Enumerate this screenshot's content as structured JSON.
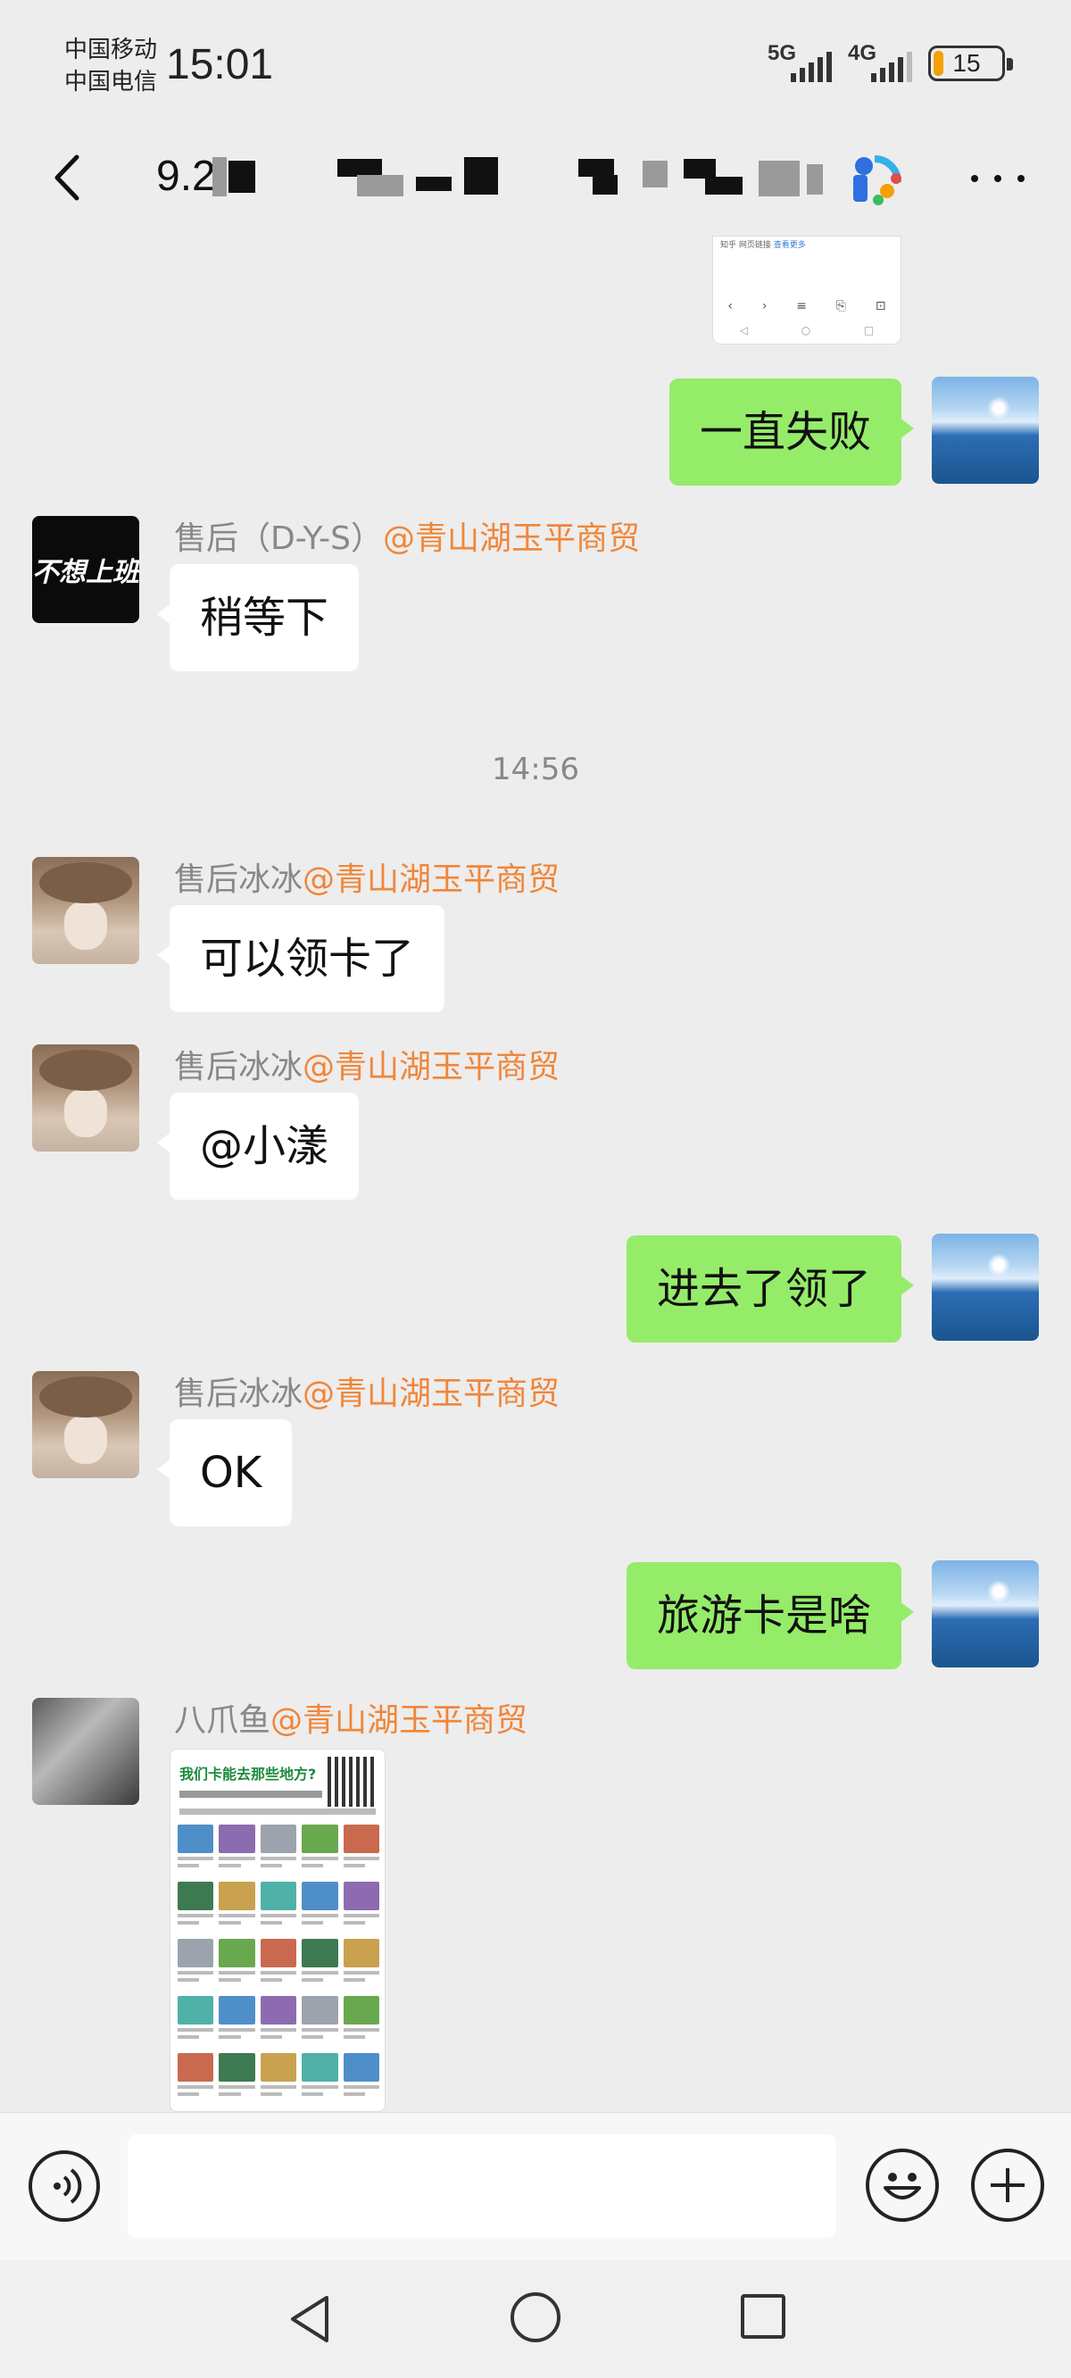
{
  "status_bar": {
    "carrier1": "中国移动",
    "carrier2": "中国电信",
    "time": "15:01",
    "net1": "5G",
    "net2": "4G",
    "battery": "15",
    "battery_level": 0.15,
    "battery_color": "#f3a000"
  },
  "title_bar": {
    "title": "9.2",
    "back_icon": "chevron-left-icon",
    "more_icon": "more-icon"
  },
  "chat": {
    "screenshot_card": {
      "text_prefix": "知乎 网页链接",
      "text_link": "查看更多",
      "nav_row": [
        "‹",
        "›",
        "≡",
        "⎘",
        "⊡"
      ],
      "sys_row": [
        "◁",
        "○",
        "□"
      ]
    },
    "messages": [
      {
        "side": "right",
        "text": "一直失败"
      },
      {
        "side": "left",
        "sender_name": "售后（D-Y-S）",
        "sender_org": "@青山湖玉平商贸",
        "text": "稍等下",
        "avatar_text": "不想上班"
      },
      {
        "timestamp": "14:56"
      },
      {
        "side": "left",
        "sender_name": "售后冰冰",
        "sender_org": "@青山湖玉平商贸",
        "text": "可以领卡了"
      },
      {
        "side": "left",
        "sender_name": "售后冰冰",
        "sender_org": "@青山湖玉平商贸",
        "text": "@小漾"
      },
      {
        "side": "right",
        "text": "进去了领了"
      },
      {
        "side": "left",
        "sender_name": "售后冰冰",
        "sender_org": "@青山湖玉平商贸",
        "text": "OK"
      },
      {
        "side": "right",
        "text": "旅游卡是啥"
      },
      {
        "side": "left",
        "sender_name": "八爪鱼",
        "sender_org": "@青山湖玉平商贸",
        "image_title": "我们卡能去那些地方?"
      }
    ]
  },
  "input_bar": {
    "placeholder": "",
    "voice_icon": "voice-icon",
    "emoji_icon": "emoji-icon",
    "plus_icon": "plus-icon"
  },
  "colors": {
    "background": "#ededed",
    "bubble_self": "#95ec69",
    "bubble_other": "#ffffff",
    "org_text": "#f0863a"
  }
}
